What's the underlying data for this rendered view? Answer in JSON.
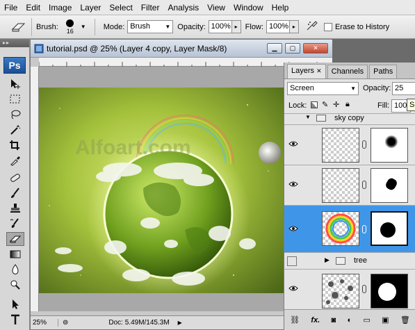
{
  "menu": [
    "File",
    "Edit",
    "Image",
    "Layer",
    "Select",
    "Filter",
    "Analysis",
    "View",
    "Window",
    "Help"
  ],
  "options": {
    "brush_label": "Brush:",
    "brush_size": "16",
    "mode_label": "Mode:",
    "mode_value": "Brush",
    "opacity_label": "Opacity:",
    "opacity_value": "100%",
    "flow_label": "Flow:",
    "flow_value": "100%",
    "erase_history_label": "Erase to History"
  },
  "toolbox": {
    "logo": "Ps"
  },
  "document": {
    "title": "tutorial.psd @ 25% (Layer 4 copy, Layer Mask/8)",
    "watermark": "Alfoart.com",
    "zoom": "25%",
    "doc_size": "Doc: 5.49M/145.3M"
  },
  "layers_panel": {
    "tabs": [
      "Layers",
      "Channels",
      "Paths"
    ],
    "blend_mode": "Screen",
    "opacity_label": "Opacity:",
    "opacity_value": "25",
    "lock_label": "Lock:",
    "fill_label": "Fill:",
    "fill_value": "100",
    "tooltip": "Se",
    "group_sky": "sky copy",
    "group_tree": "tree"
  },
  "colors": {
    "accent": "#3f96e8",
    "canvas_bg": "#9db43a"
  }
}
